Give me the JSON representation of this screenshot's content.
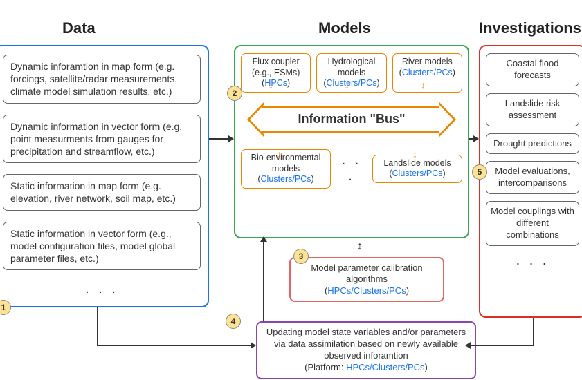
{
  "titles": {
    "data": "Data",
    "models": "Models",
    "investigations": "Investigations"
  },
  "data_items": [
    "Dynamic inforamtion in map form (e.g. forcings, satellite/radar measurements, climate model simulation results, etc.)",
    "Dynamic information in vector form (e.g. point measurments from gauges for precipitation and streamflow, etc.)",
    "Static information in map form (e.g. elevation, river network, soil map, etc.)",
    "Static information in vector form (e.g., model configuration files, model global parameter files, etc.)"
  ],
  "models_top": [
    {
      "name": "Flux coupler (e.g., ESMs)",
      "platform": "HPCs"
    },
    {
      "name": "Hydrological models",
      "platform": "Clusters/PCs"
    },
    {
      "name": "River models",
      "platform": "Clusters/PCs"
    }
  ],
  "models_bottom": [
    {
      "name": "Bio-environmental models",
      "platform": "Clusters/PCs"
    },
    {
      "name": "Landslide models",
      "platform": "Clusters/PCs"
    }
  ],
  "bus_label": "Information \"Bus\"",
  "calib": {
    "text": "Model parameter calibration algorithms",
    "platform": "HPCs/Clusters/PCs"
  },
  "assim": {
    "text": "Updating model state variables and/or parameters via data assimilation based on newly available observed inforamtion",
    "platform_prefix": "(Platform: ",
    "platform": "HPCs/Clusters/PCs",
    "platform_suffix": ")"
  },
  "investigations": [
    "Coastal flood forecasts",
    "Landslide risk assessment",
    "Drought predictions",
    "Model evaluations, intercomparisons",
    "Model couplings with different combinations"
  ],
  "badges": {
    "b1": "1",
    "b2": "2",
    "b3": "3",
    "b4": "4",
    "b5": "5"
  },
  "ellipsis": ". . ."
}
